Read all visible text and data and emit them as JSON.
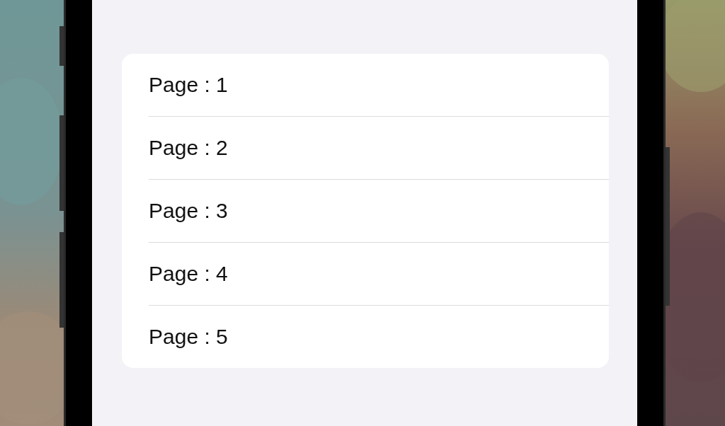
{
  "list": {
    "items": [
      {
        "label": "Page : 1"
      },
      {
        "label": "Page : 2"
      },
      {
        "label": "Page : 3"
      },
      {
        "label": "Page : 4"
      },
      {
        "label": "Page : 5"
      }
    ]
  }
}
